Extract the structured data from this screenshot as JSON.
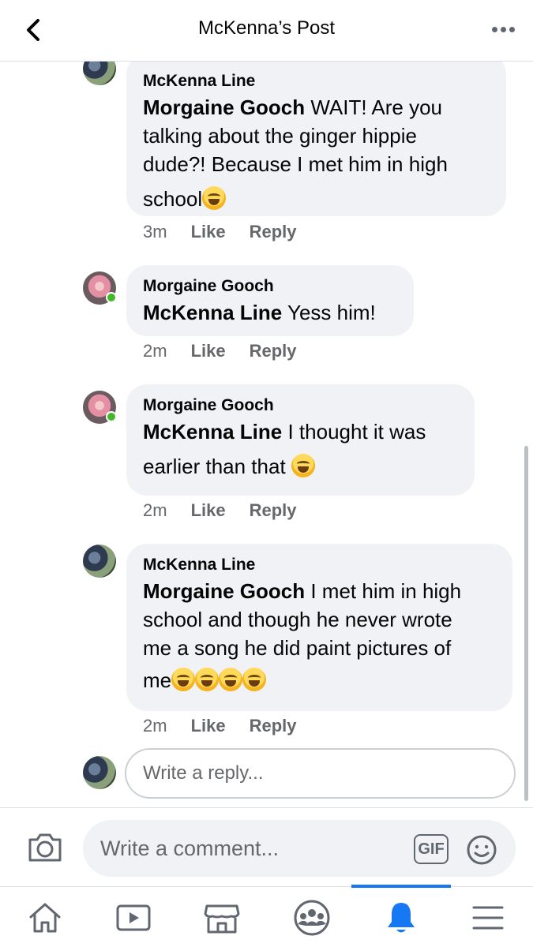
{
  "header": {
    "title": "McKenna’s Post"
  },
  "comments": [
    {
      "author": "McKenna Line",
      "mention": "Morgaine Gooch",
      "text_lines": [
        " WAIT! Are you",
        "talking about the ginger hippie",
        "dude?!  Because I met him in high",
        "school"
      ],
      "time": "3m",
      "like_label": "Like",
      "reply_label": "Reply"
    },
    {
      "author": "Morgaine Gooch",
      "mention": "McKenna Line",
      "text": " Yess him!",
      "time": "2m",
      "like_label": "Like",
      "reply_label": "Reply"
    },
    {
      "author": "Morgaine Gooch",
      "mention": "McKenna Line",
      "text_line1": " I thought it was",
      "text_line2": "earlier than that ",
      "time": "2m",
      "like_label": "Like",
      "reply_label": "Reply"
    },
    {
      "author": "McKenna Line",
      "mention": "Morgaine Gooch",
      "text_lines": [
        " I met him in high",
        "school and though he never wrote",
        "me a song he did paint pictures of",
        "me"
      ],
      "time": "2m",
      "like_label": "Like",
      "reply_label": "Reply"
    }
  ],
  "reply_box": {
    "placeholder": "Write a reply..."
  },
  "composer": {
    "placeholder": "Write a comment...",
    "gif_label": "GIF"
  },
  "bottom_nav": {
    "items": [
      "home-icon",
      "watch-icon",
      "marketplace-icon",
      "groups-icon",
      "notifications-icon",
      "menu-icon"
    ],
    "active": "notifications-icon"
  },
  "colors": {
    "accent": "#1877f2",
    "bubble": "#f0f2f5",
    "online": "#42b72a",
    "secondary_text": "#65676b"
  }
}
